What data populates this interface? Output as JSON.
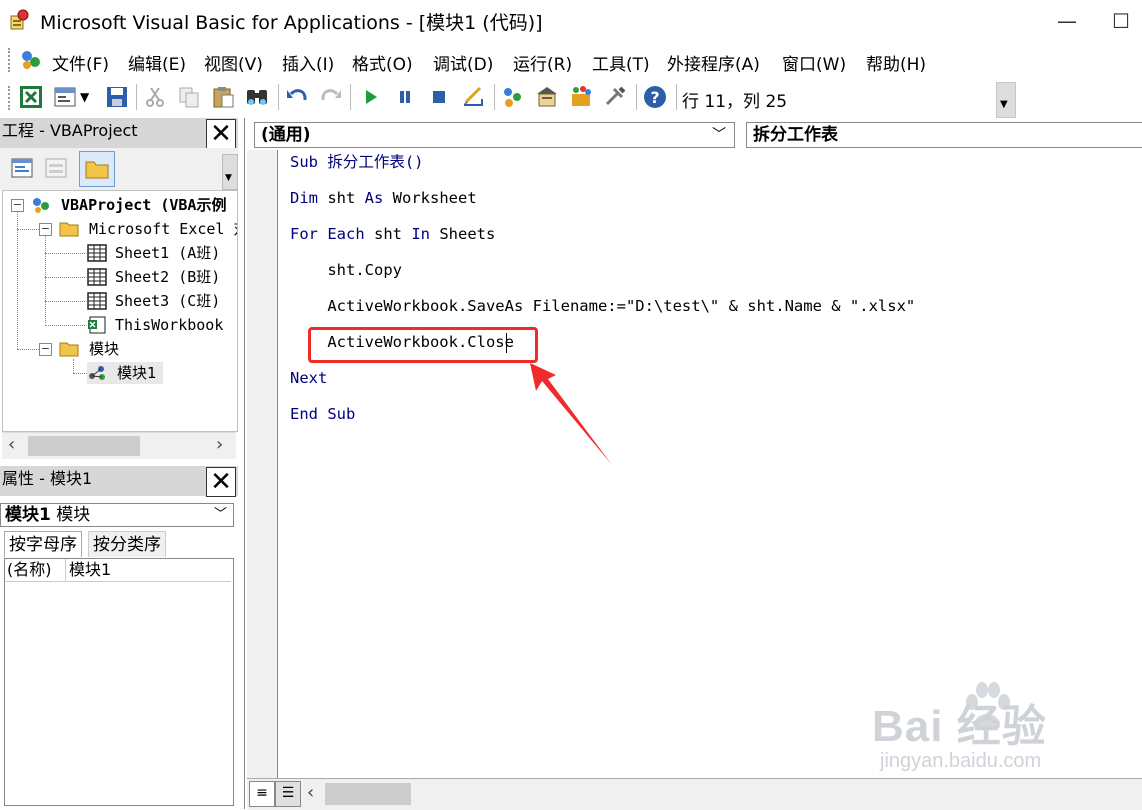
{
  "window": {
    "title": "Microsoft Visual Basic for Applications - [模块1 (代码)]",
    "minimize_glyph": "—",
    "restore_glyph": "☐"
  },
  "menu": {
    "items": [
      "文件(F)",
      "编辑(E)",
      "视图(V)",
      "插入(I)",
      "格式(O)",
      "调试(D)",
      "运行(R)",
      "工具(T)",
      "外接程序(A)",
      "窗口(W)",
      "帮助(H)"
    ]
  },
  "toolbar": {
    "cursor_position": "行 11，列 25"
  },
  "project": {
    "title": "工程 - VBAProject",
    "tree": {
      "root": "VBAProject (VBA示例",
      "excel_objects": "Microsoft Excel 对",
      "sheet1": "Sheet1 (A班)",
      "sheet2": "Sheet2 (B班)",
      "sheet3": "Sheet3 (C班)",
      "thisworkbook": "ThisWorkbook",
      "modules": "模块",
      "module1": "模块1"
    }
  },
  "properties": {
    "title": "属性 - 模块1",
    "object_bold": "模块1",
    "object_type": "模块",
    "tabs": [
      "按字母序",
      "按分类序"
    ],
    "row_name": "(名称)",
    "row_value": "模块1"
  },
  "code": {
    "object_combo": "(通用)",
    "procedure_combo": "拆分工作表",
    "line1_kw": "Sub",
    "line1_rest": " 拆分工作表()",
    "line2_kw1": "Dim",
    "line2_mid": " sht ",
    "line2_kw2": "As",
    "line2_rest": " Worksheet",
    "line3_kw1": "For",
    "line3_sp1": " ",
    "line3_kw2": "Each",
    "line3_mid": " sht ",
    "line3_kw3": "In",
    "line3_rest": " Sheets",
    "line4": "    sht.Copy",
    "line5": "    ActiveWorkbook.SaveAs Filename:=\"D:\\test\\\" & sht.Name & \".xlsx\"",
    "line6": "    ActiveWorkbook.Close",
    "line7_kw": "Next",
    "line8_kw1": "End",
    "line8_sp": " ",
    "line8_kw2": "Sub"
  },
  "watermark": {
    "brand": "Bai 经验",
    "url": "jingyan.baidu.com"
  },
  "colors": {
    "keyword": "#00007f",
    "highlight": "#f02b2b",
    "pane_title": "#d7d7d7"
  }
}
